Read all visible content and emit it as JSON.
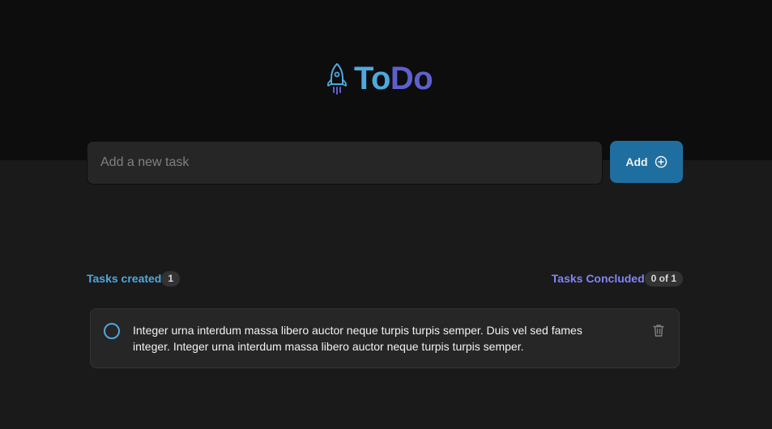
{
  "app": {
    "logo_part1": "To",
    "logo_part2": "Do",
    "icon": "rocket-icon"
  },
  "form": {
    "placeholder": "Add a new task",
    "value": "",
    "add_label": "Add",
    "add_icon": "plus-circle-icon"
  },
  "counters": {
    "created_label": "Tasks created",
    "created_count": "1",
    "concluded_label": "Tasks Concluded",
    "concluded_count": "0 of 1"
  },
  "tasks": [
    {
      "text": "Integer urna interdum massa libero auctor neque turpis turpis semper. Duis vel sed fames integer. Integer urna interdum massa libero auctor neque turpis turpis semper.",
      "done": false,
      "delete_icon": "trash-icon"
    }
  ],
  "colors": {
    "blue": "#4ea8de",
    "purple": "#5e60ce",
    "purple_light": "#8284fa",
    "button": "#1e6f9f",
    "header_bg": "#0d0d0d",
    "body_bg": "#1a1a1a",
    "card_bg": "#262626"
  }
}
